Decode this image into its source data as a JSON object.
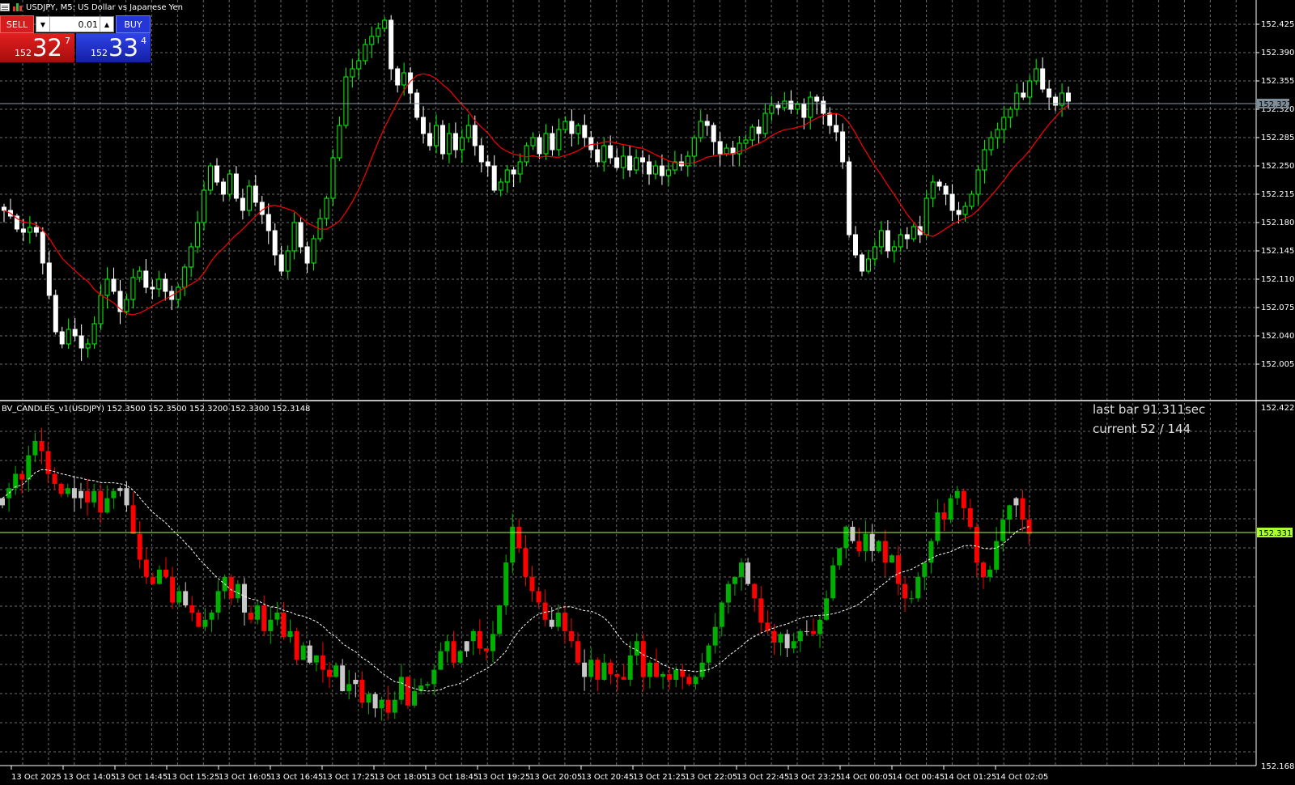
{
  "window": {
    "title": "USDJPY, M5:  US Dollar vs Japanese Yen"
  },
  "trade_panel": {
    "sell_label": "SELL",
    "buy_label": "BUY",
    "lot_value": "0.01",
    "sell_price": {
      "prefix": "152",
      "big": "32",
      "sup": "7"
    },
    "buy_price": {
      "prefix": "152",
      "big": "33",
      "sup": "4"
    }
  },
  "indicator": {
    "label": "BV_CANDLES_v1(USDJPY) 152.3500 152.3500 152.3200 152.3300 152.3148",
    "last_bar": "last bar 91.311sec",
    "current": "current 52 / 144",
    "top_label": "152.4221",
    "bottom_label": "152.1680",
    "price_marker": "152.3310"
  },
  "colors": {
    "background": "#000000",
    "grid": "#6b6b6b",
    "bull_main": "#00ff00",
    "bear_main": "#ffffff",
    "ma_main": "#ff0000",
    "bull_ind": "#00b000",
    "bear_ind": "#ff0000",
    "neutral_ind": "#c8c8c8",
    "ma_ind": "#ffffff",
    "marker_ind": "#aaff33"
  },
  "chart_data": [
    {
      "type": "candlestick",
      "title": "USDJPY, M5",
      "ylim": [
        151.962,
        152.455
      ],
      "y_ticks": [
        "152.425",
        "152.390",
        "152.355",
        "152.320",
        "152.285",
        "152.250",
        "152.215",
        "152.180",
        "152.145",
        "152.110",
        "152.075",
        "152.040",
        "152.005"
      ],
      "bid_marker": "152.327",
      "x_ticks": [
        "13 Oct 2025",
        "13 Oct 14:05",
        "13 Oct 14:45",
        "13 Oct 15:25",
        "13 Oct 16:05",
        "13 Oct 16:45",
        "13 Oct 17:25",
        "13 Oct 18:05",
        "13 Oct 18:45",
        "13 Oct 19:25",
        "13 Oct 20:05",
        "13 Oct 20:45",
        "13 Oct 21:25",
        "13 Oct 22:05",
        "13 Oct 22:45",
        "13 Oct 23:25",
        "14 Oct 00:05",
        "14 Oct 00:45",
        "14 Oct 01:25",
        "14 Oct 02:05"
      ],
      "closes": [
        152.195,
        152.188,
        152.172,
        152.168,
        152.174,
        152.168,
        152.13,
        152.09,
        152.045,
        152.03,
        152.048,
        152.04,
        152.025,
        152.03,
        152.055,
        152.09,
        152.11,
        152.095,
        152.07,
        152.085,
        152.112,
        152.12,
        152.1,
        152.098,
        152.11,
        152.095,
        152.085,
        152.1,
        152.125,
        152.15,
        152.18,
        152.22,
        152.25,
        152.23,
        152.215,
        152.24,
        152.21,
        152.195,
        152.225,
        152.205,
        152.19,
        152.17,
        152.14,
        152.12,
        152.145,
        152.18,
        152.15,
        152.13,
        152.16,
        152.185,
        152.21,
        152.26,
        152.3,
        152.36,
        152.37,
        152.38,
        152.4,
        152.41,
        152.42,
        152.43,
        152.37,
        152.35,
        152.365,
        152.34,
        152.31,
        152.29,
        152.275,
        152.3,
        152.265,
        152.29,
        152.27,
        152.285,
        152.3,
        152.275,
        152.255,
        152.25,
        152.22,
        152.23,
        152.245,
        152.24,
        152.255,
        152.275,
        152.285,
        152.265,
        152.29,
        152.27,
        152.295,
        152.305,
        152.29,
        152.3,
        152.285,
        152.27,
        152.255,
        152.275,
        152.26,
        152.248,
        152.262,
        152.245,
        152.26,
        152.255,
        152.24,
        152.25,
        152.238,
        152.245,
        152.255,
        152.25,
        152.262,
        152.285,
        152.305,
        152.3,
        152.28,
        152.265,
        152.272,
        152.265,
        152.278,
        152.282,
        152.298,
        152.29,
        152.315,
        152.325,
        152.322,
        152.33,
        152.32,
        152.326,
        152.31,
        152.335,
        152.33,
        152.315,
        152.3,
        152.292,
        152.255,
        152.165,
        152.14,
        152.12,
        152.135,
        152.15,
        152.17,
        152.145,
        152.15,
        152.165,
        152.16,
        152.175,
        152.165,
        152.21,
        152.23,
        152.225,
        152.215,
        152.195,
        152.19,
        152.2,
        152.215,
        152.245,
        152.27,
        152.285,
        152.295,
        152.31,
        152.32,
        152.34,
        152.335,
        152.355,
        152.37,
        152.345,
        152.335,
        152.325,
        152.34,
        152.33
      ]
    },
    {
      "type": "candlestick",
      "title": "BV_CANDLES_v1(USDJPY)",
      "ylim": [
        152.168,
        152.4221
      ],
      "x_ticks": [
        "13 Oct 2025",
        "13 Oct 14:05",
        "13 Oct 14:45",
        "13 Oct 15:25",
        "13 Oct 16:05",
        "13 Oct 16:45",
        "13 Oct 17:25",
        "13 Oct 18:05",
        "13 Oct 18:45",
        "13 Oct 19:25",
        "13 Oct 20:05",
        "13 Oct 20:45",
        "13 Oct 21:25",
        "13 Oct 22:05",
        "13 Oct 22:45",
        "13 Oct 23:25",
        "14 Oct 00:05",
        "14 Oct 00:45",
        "14 Oct 01:25",
        "14 Oct 02:05"
      ],
      "closes": [
        152.355,
        152.362,
        152.372,
        152.368,
        152.385,
        152.395,
        152.388,
        152.372,
        152.365,
        152.358,
        152.362,
        152.355,
        152.36,
        152.352,
        152.36,
        152.345,
        152.355,
        152.36,
        152.362,
        152.35,
        152.33,
        152.312,
        152.3,
        152.295,
        152.305,
        152.3,
        152.282,
        152.29,
        152.28,
        152.275,
        152.265,
        152.27,
        152.275,
        152.29,
        152.3,
        152.285,
        152.295,
        152.275,
        152.27,
        152.28,
        152.262,
        152.27,
        152.275,
        152.258,
        152.262,
        152.242,
        152.252,
        152.24,
        152.245,
        152.235,
        152.23,
        152.238,
        152.22,
        152.225,
        152.228,
        152.212,
        152.218,
        152.208,
        152.214,
        152.205,
        152.214,
        152.23,
        152.21,
        152.22,
        152.224,
        152.225,
        152.235,
        152.248,
        152.255,
        152.24,
        152.248,
        152.255,
        152.262,
        152.25,
        152.248,
        152.26,
        152.28,
        152.31,
        152.335,
        152.32,
        152.3,
        152.29,
        152.282,
        152.27,
        152.265,
        152.275,
        152.262,
        152.255,
        152.24,
        152.23,
        152.242,
        152.228,
        152.24,
        152.232,
        152.23,
        152.228,
        152.245,
        152.255,
        152.23,
        152.24,
        152.23,
        152.232,
        152.228,
        152.235,
        152.23,
        152.225,
        152.23,
        152.24,
        152.252,
        152.265,
        152.282,
        152.295,
        152.3,
        152.31,
        152.295,
        152.285,
        152.268,
        152.262,
        152.254,
        152.26,
        152.25,
        152.255,
        152.262,
        152.262,
        152.26,
        152.27,
        152.285,
        152.308,
        152.32,
        152.335,
        152.325,
        152.318,
        152.33,
        152.318,
        152.325,
        152.31,
        152.315,
        152.295,
        152.285,
        152.285,
        152.3,
        152.31,
        152.325,
        152.345,
        152.34,
        152.355,
        152.36,
        152.348,
        152.335,
        152.31,
        152.3,
        152.305,
        152.325,
        152.34,
        152.35,
        152.355,
        152.34,
        152.33
      ]
    }
  ]
}
